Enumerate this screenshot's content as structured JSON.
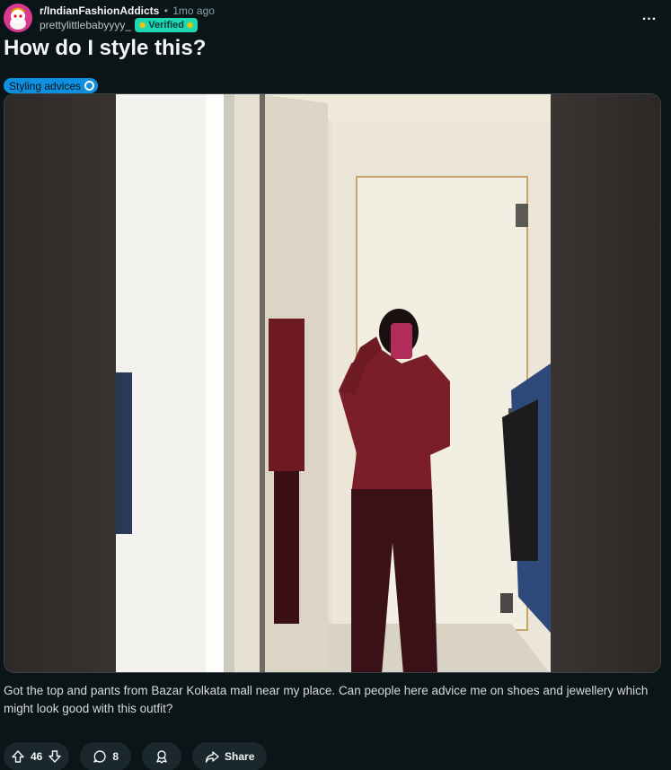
{
  "header": {
    "subreddit": "r/IndianFashionAddicts",
    "separator": "•",
    "time_ago": "1mo ago",
    "username": "prettylittlebabyyyy_",
    "badge": "Verified",
    "more_label": "..."
  },
  "post": {
    "title": "How do I style this?",
    "flair": "Styling advices",
    "body": "Got the top and pants from Bazar Kolkata mall near my place. Can people here advice me on shoes and jewellery which might look good with this outfit?"
  },
  "actions": {
    "upvotes": "46",
    "comments": "8",
    "share_label": "Share"
  },
  "icons": {
    "upvote": "arrow-up-outline-icon",
    "downvote": "arrow-down-outline-icon",
    "comment": "speech-bubble-icon",
    "award": "award-ribbon-icon",
    "share": "share-arrow-icon",
    "more": "ellipsis-icon",
    "flair_indicator": "circle-icon"
  },
  "colors": {
    "background": "#0b1416",
    "flair_bg": "#0e8fe0",
    "badge_bg": "#1ed7b3",
    "pill_bg": "#1a282d"
  }
}
